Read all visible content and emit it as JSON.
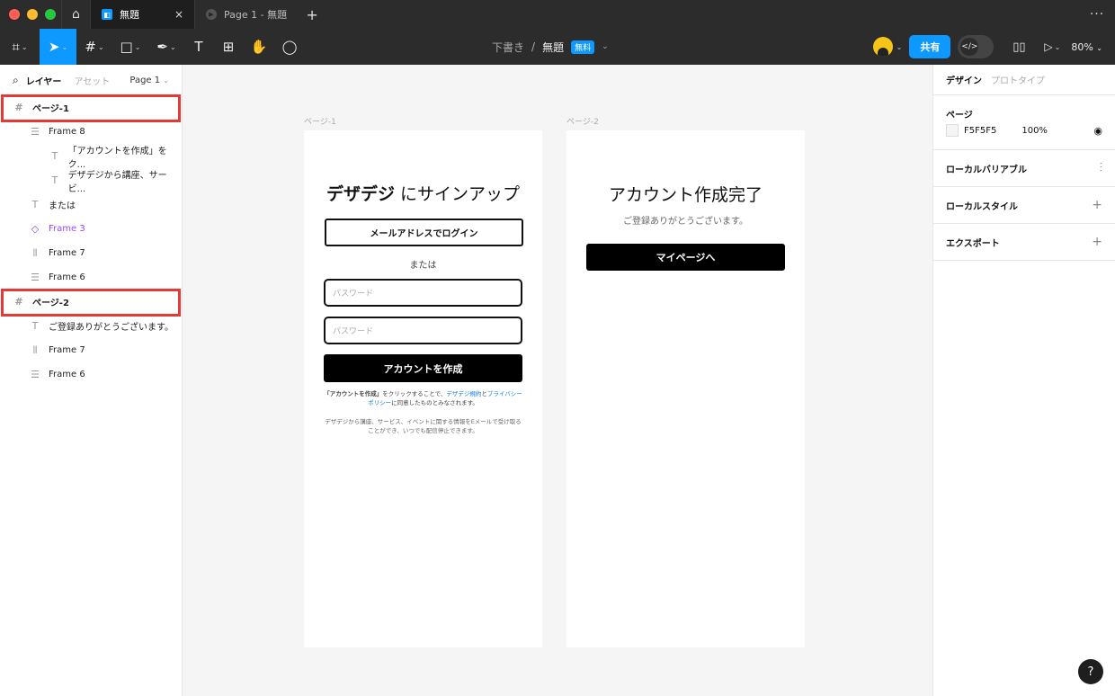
{
  "colors": {
    "accent": "#0d99ff",
    "highlight": "#e53935",
    "traffic_red": "#ff5f57",
    "traffic_yellow": "#febc2e",
    "traffic_green": "#28c840"
  },
  "titlebar": {
    "tabs": [
      {
        "label": "無題",
        "icon": "file-icon",
        "close": "×"
      },
      {
        "label": "Page 1 - 無題",
        "icon": "play-icon"
      }
    ],
    "new_tab": "+",
    "more": "···"
  },
  "toolbar": {
    "breadcrumb_drafts": "下書き",
    "separator": "/",
    "file_name": "無題",
    "plan_badge": "無料",
    "share_label": "共有",
    "zoom": "80%"
  },
  "left_panel": {
    "tab_layers": "レイヤー",
    "tab_assets": "アセット",
    "page_selector": "Page 1",
    "layers": [
      {
        "label": "ページ-1",
        "icon": "frame-icon",
        "level": 0
      },
      {
        "label": "Frame 8",
        "icon": "auto-layout-icon",
        "level": 1
      },
      {
        "label": "「アカウントを作成」をク...",
        "icon": "text-icon",
        "level": 2
      },
      {
        "label": "デザデジから講座、サービ...",
        "icon": "text-icon",
        "level": 2
      },
      {
        "label": "または",
        "icon": "text-icon",
        "level": 1
      },
      {
        "label": "Frame 3",
        "icon": "component-icon",
        "level": 1
      },
      {
        "label": "Frame 7",
        "icon": "auto-layout-vertical-icon",
        "level": 1
      },
      {
        "label": "Frame 6",
        "icon": "auto-layout-icon",
        "level": 1
      },
      {
        "label": "ページ-2",
        "icon": "frame-icon",
        "level": 0
      },
      {
        "label": "ご登録ありがとうございます。",
        "icon": "text-icon",
        "level": 1
      },
      {
        "label": "Frame 7",
        "icon": "auto-layout-vertical-icon",
        "level": 1
      },
      {
        "label": "Frame 6",
        "icon": "auto-layout-icon",
        "level": 1
      }
    ]
  },
  "right_panel": {
    "tab_design": "デザイン",
    "tab_prototype": "プロトタイプ",
    "page_section": "ページ",
    "page_color": "F5F5F5",
    "page_opacity": "100%",
    "local_variables": "ローカルバリアブル",
    "local_styles": "ローカルスタイル",
    "export": "エクスポート"
  },
  "canvas": {
    "frame1_label": "ページ-1",
    "frame2_label": "ページ-2",
    "signup_brand": "デザデジ",
    "signup_rest": " にサインアップ",
    "email_login": "メールアドレスでログイン",
    "or": "または",
    "password_placeholder_1": "パスワード",
    "password_placeholder_2": "パスワード",
    "create_account": "アカウントを作成",
    "terms_bold": "「アカウントを作成」",
    "terms_text1": "をクリックすることで、",
    "terms_link1": "デザデジ規約",
    "terms_and": "と",
    "terms_link2": "プライバシーポリシー",
    "terms_text2": "に同意したものとみなされます。",
    "marketing": "デザデジから講座、サービス、イベントに関する情報をEメールで受け取ることができ、いつでも配信停止できます。",
    "done_title": "アカウント作成完了",
    "done_sub": "ご登録ありがとうございます。",
    "mypage": "マイページへ"
  },
  "help": "?"
}
